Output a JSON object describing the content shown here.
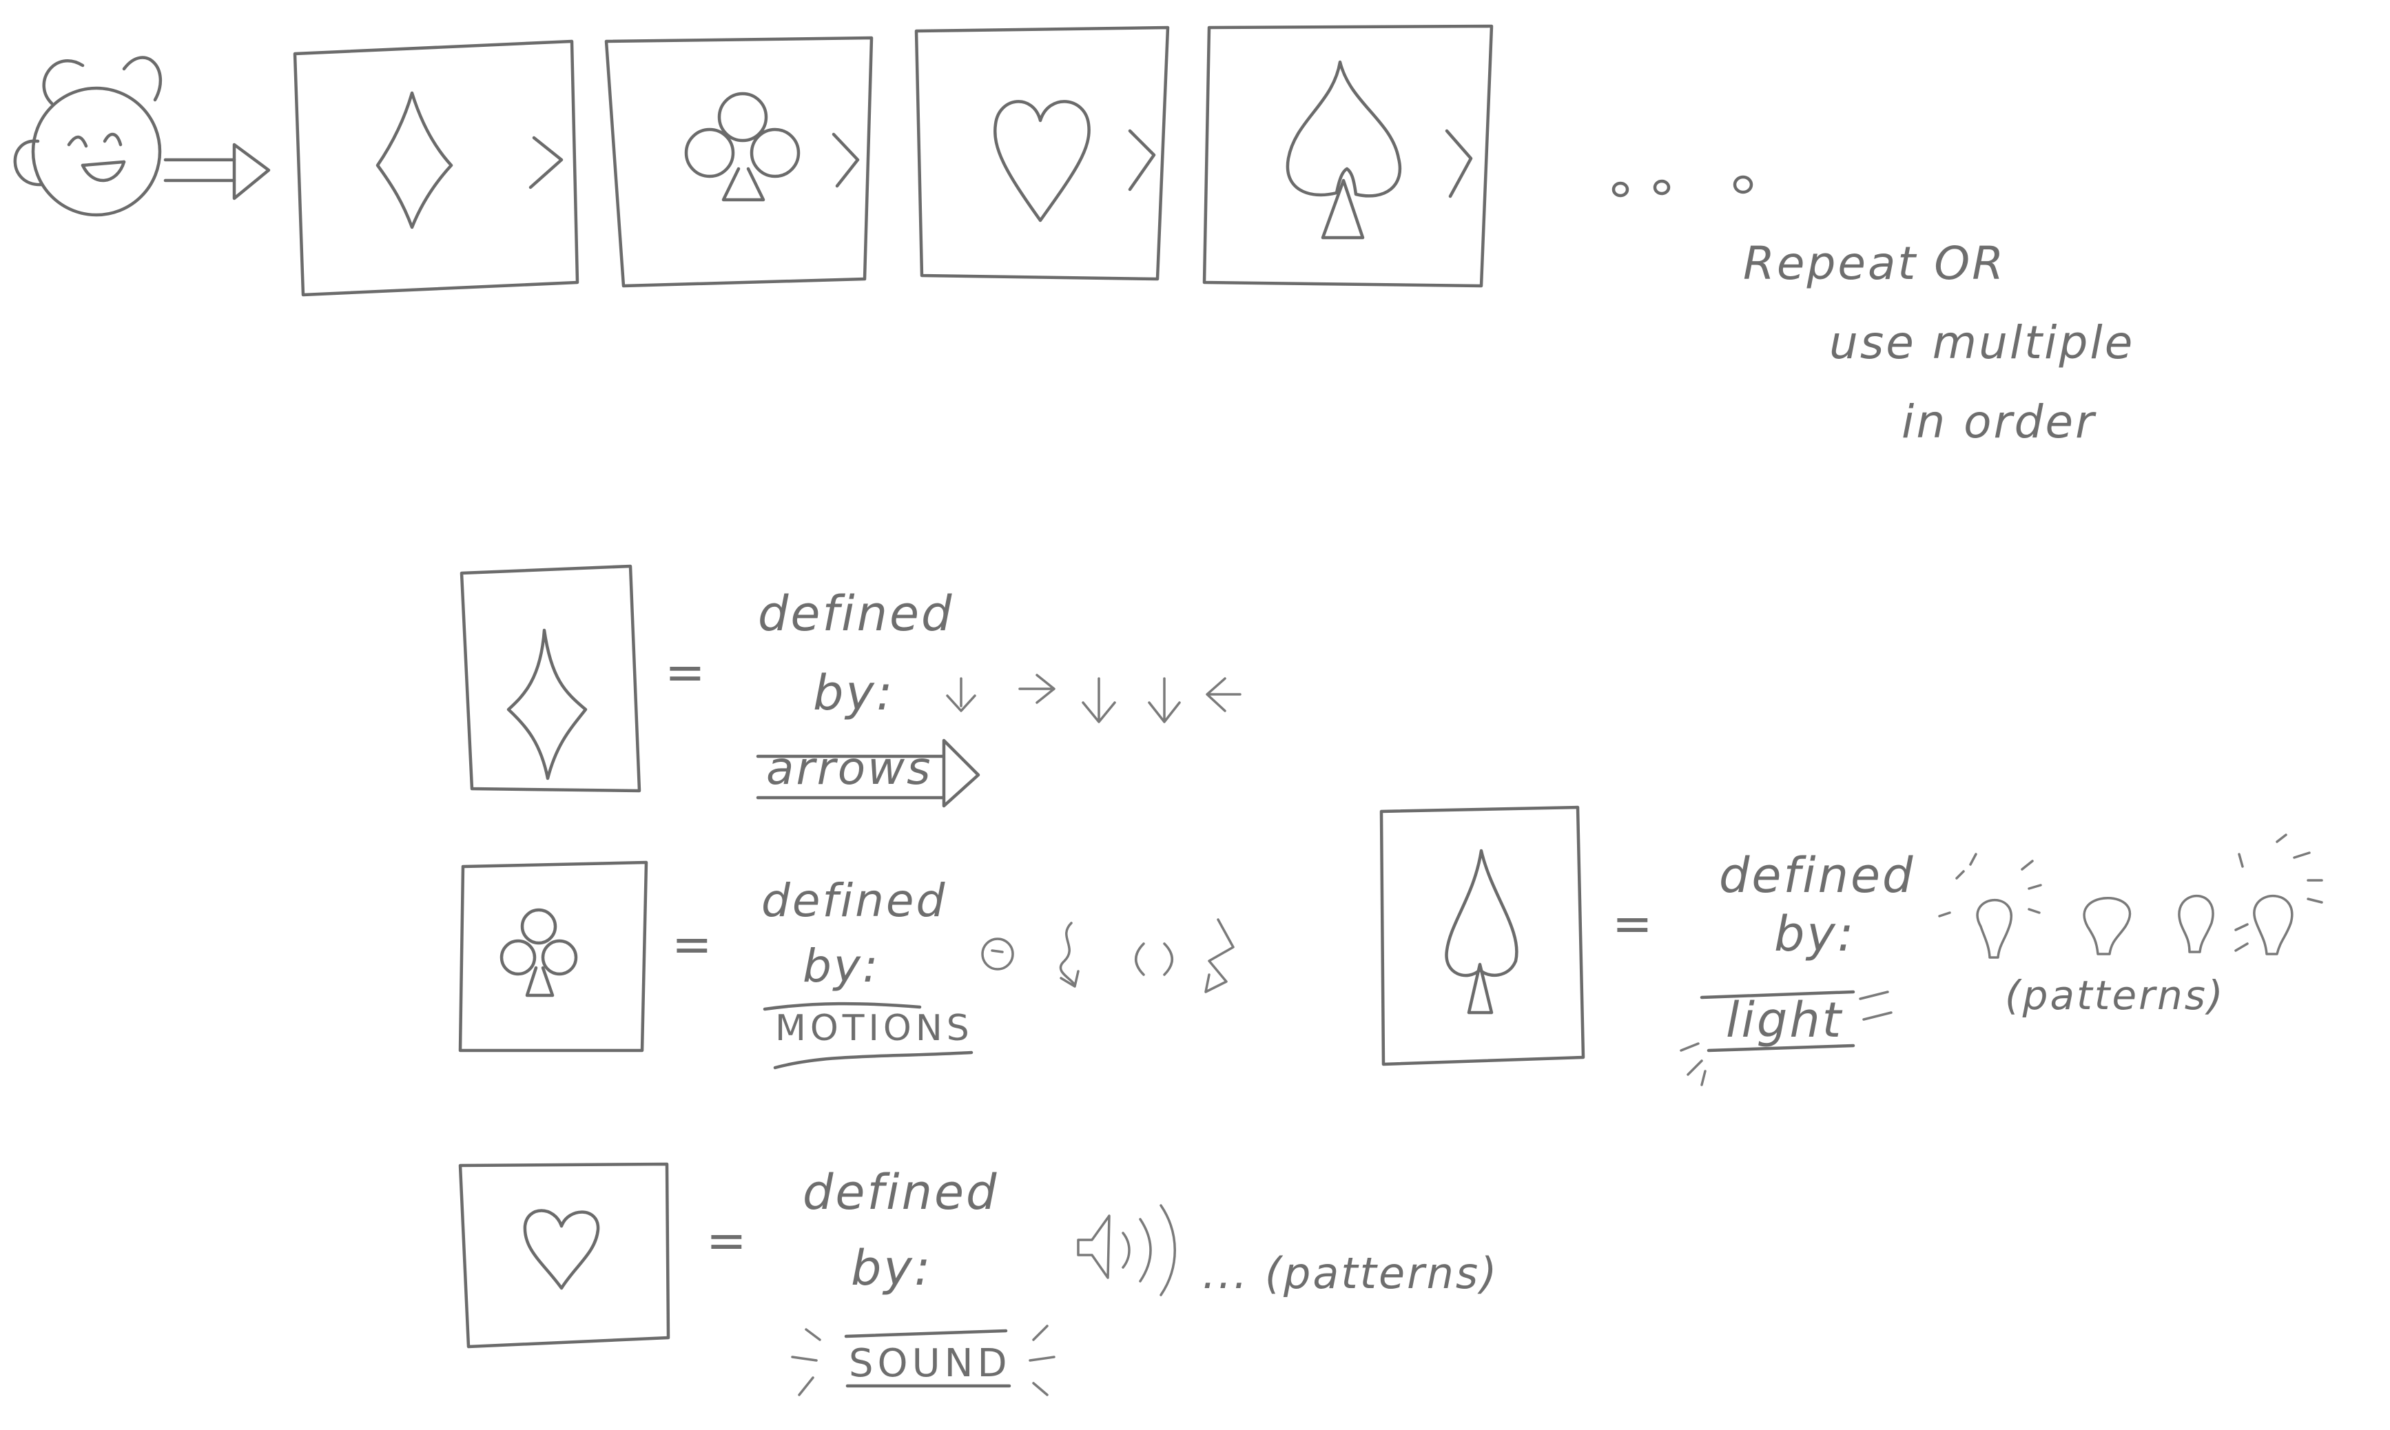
{
  "sequence": {
    "continuation": "o o o",
    "note_lines": [
      "Repeat OR",
      "use multiple",
      "in order"
    ],
    "cards": [
      {
        "suit": "diamond-icon"
      },
      {
        "suit": "club-icon"
      },
      {
        "suit": "heart-icon"
      },
      {
        "suit": "spade-icon"
      }
    ]
  },
  "definitions": {
    "diamond": {
      "equals": "=",
      "line1": "defined",
      "line2": "by:",
      "label": "arrows"
    },
    "club": {
      "equals": "=",
      "line1": "defined",
      "line2": "by:",
      "label": "MOTIONS"
    },
    "heart": {
      "equals": "=",
      "line1": "defined",
      "line2": "by:",
      "label": "SOUND",
      "trail": "... (patterns)"
    },
    "spade": {
      "equals": "=",
      "line1": "defined",
      "line2": "by:",
      "label": "light",
      "trail": "(patterns)"
    }
  },
  "colors": {
    "ink": "#6b6b6b",
    "paper": "#ffffff"
  }
}
